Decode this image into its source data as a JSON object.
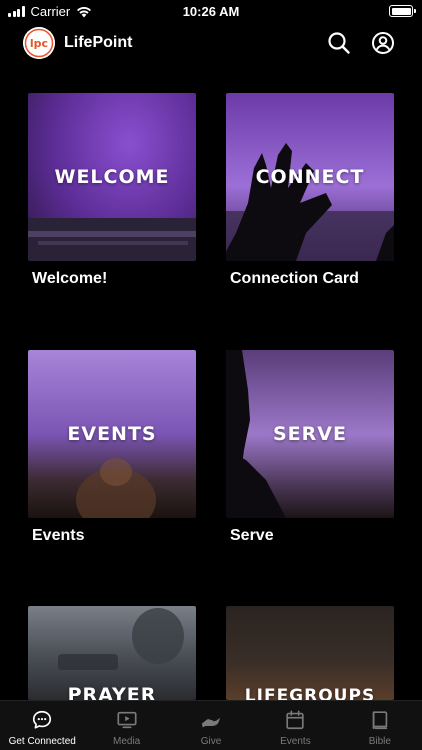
{
  "status_bar": {
    "carrier": "Carrier",
    "time": "10:26 AM"
  },
  "header": {
    "logo_text": "lpc",
    "title": "LifePoint"
  },
  "tiles": [
    {
      "image_text": "WELCOME",
      "caption": "Welcome!"
    },
    {
      "image_text": "CONNECT",
      "caption": "Connection Card"
    },
    {
      "image_text": "EVENTS",
      "caption": "Events"
    },
    {
      "image_text": "SERVE",
      "caption": "Serve"
    },
    {
      "image_text": "PRAYER",
      "caption": ""
    },
    {
      "image_text": "LIFEGROUPS",
      "caption": ""
    }
  ],
  "tab_bar": {
    "items": [
      {
        "label": "Get Connected",
        "icon": "chat-bubble-icon",
        "active": true
      },
      {
        "label": "Media",
        "icon": "play-screen-icon",
        "active": false
      },
      {
        "label": "Give",
        "icon": "giving-hand-icon",
        "active": false
      },
      {
        "label": "Events",
        "icon": "calendar-icon",
        "active": false
      },
      {
        "label": "Bible",
        "icon": "book-icon",
        "active": false
      }
    ]
  },
  "colors": {
    "background": "#000000",
    "logo_accent": "#E8552B",
    "tab_active": "#FFFFFF",
    "tab_inactive": "#7A7A7A"
  }
}
